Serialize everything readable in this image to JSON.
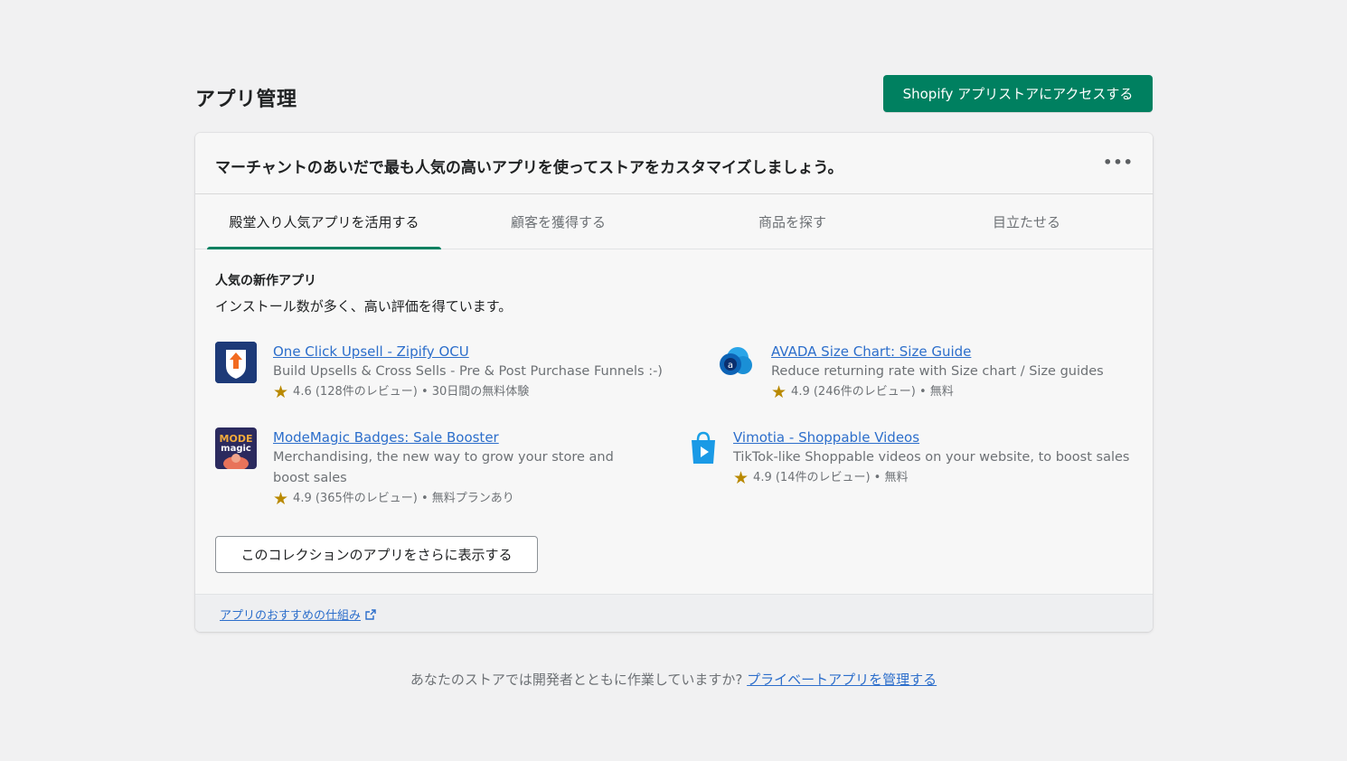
{
  "page": {
    "title": "アプリ管理"
  },
  "header": {
    "store_button": "Shopify アプリストアにアクセスする"
  },
  "card": {
    "heading": "マーチャントのあいだで最も人気の高いアプリを使ってストアをカスタマイズしましょう。",
    "more_actions": "•••",
    "tabs": [
      {
        "label": "殿堂入り人気アプリを活用する",
        "active": true
      },
      {
        "label": "顧客を獲得する",
        "active": false
      },
      {
        "label": "商品を探す",
        "active": false
      },
      {
        "label": "目立たせる",
        "active": false
      }
    ],
    "section_title": "人気の新作アプリ",
    "section_subtitle": "インストール数が多く、高い評価を得ています。",
    "apps": [
      {
        "name": "One Click Upsell ‑ Zipify OCU",
        "description": "Build Upsells & Cross Sells - Pre & Post Purchase Funnels :-)",
        "meta": "4.6 (128件のレビュー) • 30日間の無料体験",
        "icon": "upsell-arrow-icon"
      },
      {
        "name": "AVADA Size Chart: Size Guide",
        "description": "Reduce returning rate with Size chart / Size guides",
        "meta": "4.9 (246件のレビュー) • 無料",
        "icon": "avada-cloud-icon"
      },
      {
        "name": "ModeMagic Badges: Sale Booster",
        "description": "Merchandising, the new way to grow your store and boost sales",
        "meta": "4.9 (365件のレビュー) • 無料プランあり",
        "icon": "modemagic-logo-icon"
      },
      {
        "name": "Vimotia ‑ Shoppable Videos",
        "description": "TikTok-like Shoppable videos on your website, to boost sales",
        "meta": "4.9 (14件のレビュー) • 無料",
        "icon": "shopping-bag-play-icon"
      }
    ],
    "show_more_button": "このコレクションのアプリをさらに表示する",
    "footer_link": "アプリのおすすめの仕組み"
  },
  "bottom": {
    "note": "あなたのストアでは開発者とともに作業していますか? ",
    "link": "プライベートアプリを管理する"
  },
  "colors": {
    "primary": "#008060",
    "link": "#2c6ecb",
    "star": "#b98900"
  }
}
